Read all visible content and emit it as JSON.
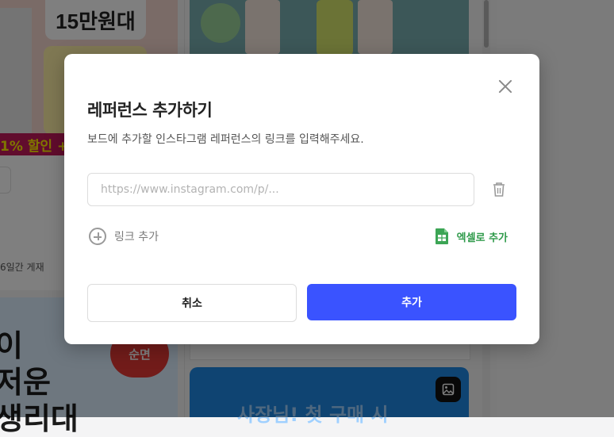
{
  "background": {
    "card1_price": "15만원대",
    "card1_band": "1% 할인 +",
    "card3_text": "이\n저운\n생리대",
    "card3_badge": "순면",
    "card4_text": "사장님! 첫 구매 시",
    "duration": "6일간 게재"
  },
  "modal": {
    "title": "레퍼런스 추가하기",
    "description": "보드에 추가할 인스타그램 레퍼런스의 링크를 입력해주세요.",
    "input_placeholder": "https://www.instagram.com/p/...",
    "input_value": "",
    "add_link_label": "링크 추가",
    "excel_label": "엑셀로 추가",
    "cancel_label": "취소",
    "submit_label": "추가"
  },
  "colors": {
    "primary": "#3a53ff",
    "excel_green": "#2e9a4a",
    "overlay": "rgba(0,0,0,0.5)"
  },
  "icons": {
    "close": "close-icon",
    "trash": "trash-icon",
    "add": "plus-circle-icon",
    "excel": "spreadsheet-icon",
    "image": "image-icon"
  }
}
